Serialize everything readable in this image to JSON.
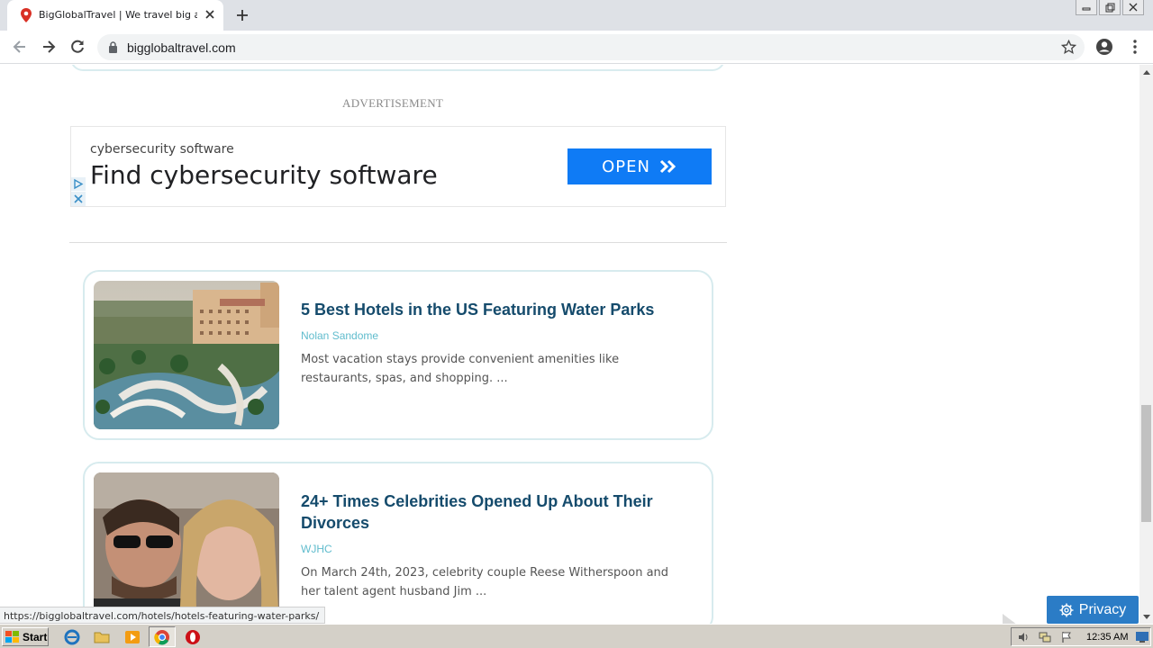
{
  "browser": {
    "tab_title": "BigGlobalTravel | We travel big and o",
    "url": "bigglobaltravel.com",
    "status_url": "https://bigglobaltravel.com/hotels/hotels-featuring-water-parks/"
  },
  "ad": {
    "label": "ADVERTISEMENT",
    "small_text": "cybersecurity software",
    "headline": "Find cybersecurity software",
    "button_label": "OPEN",
    "button_color": "#0f7bf5"
  },
  "articles": [
    {
      "title": "5 Best Hotels in the US Featuring Water Parks",
      "author": "Nolan Sandome",
      "excerpt": "Most vacation stays provide convenient amenities like restaurants, spas, and shopping. ..."
    },
    {
      "title": "24+ Times Celebrities Opened Up About Their Divorces",
      "author": "WJHC",
      "excerpt": "On March 24th, 2023, celebrity couple Reese Witherspoon and her talent agent husband Jim ..."
    }
  ],
  "privacy": {
    "label": "Privacy"
  },
  "taskbar": {
    "start_label": "Start",
    "clock": "12:35 AM"
  },
  "colors": {
    "title": "#154b6c",
    "author": "#60bccd",
    "card_border": "#d7ebee"
  }
}
